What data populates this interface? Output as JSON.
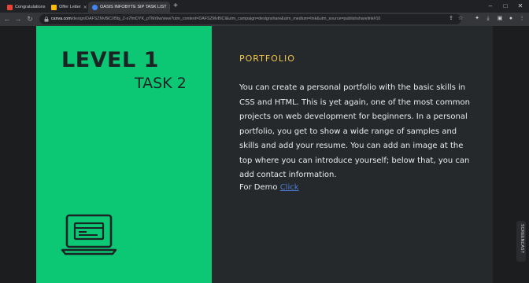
{
  "browser": {
    "tabs": [
      {
        "title": "Congratulations",
        "favicon_color": "#ea4335",
        "active": false
      },
      {
        "title": "Offer Letter",
        "favicon_color": "#fbbc04",
        "active": false
      },
      {
        "title": "OASIS INFOBYTE SIP TASK LIST",
        "favicon_color": "#4285f4",
        "active": true
      }
    ],
    "url_domain": "canva.com",
    "url_path": "/design/DAFSZMvBiCI/Bbj_Z-s7fmDYK_pTMr9w/view?utm_content=DAFSZMvBiCI&utm_campaign=designshare&utm_medium=link&utm_source=publishsharelink#10"
  },
  "slide": {
    "level_title": "LEVEL 1",
    "task_title": "TASK 2",
    "section_heading": "PORTFOLIO",
    "description": "You can create a personal portfolio with the basic skills in CSS and HTML. This is yet again, one of the most common projects on web development for beginners. In a personal portfolio, you get to show a wide range of samples and skills and add your resume. You can add an image at the top where you can introduce yourself; below that, you can add contact information.",
    "demo_prefix": "For Demo",
    "demo_link": "Click",
    "colors": {
      "panel": "#0cc874",
      "heading": "#f0c64a",
      "background": "#26292c"
    }
  },
  "extension_badge": "SCREENCAST"
}
